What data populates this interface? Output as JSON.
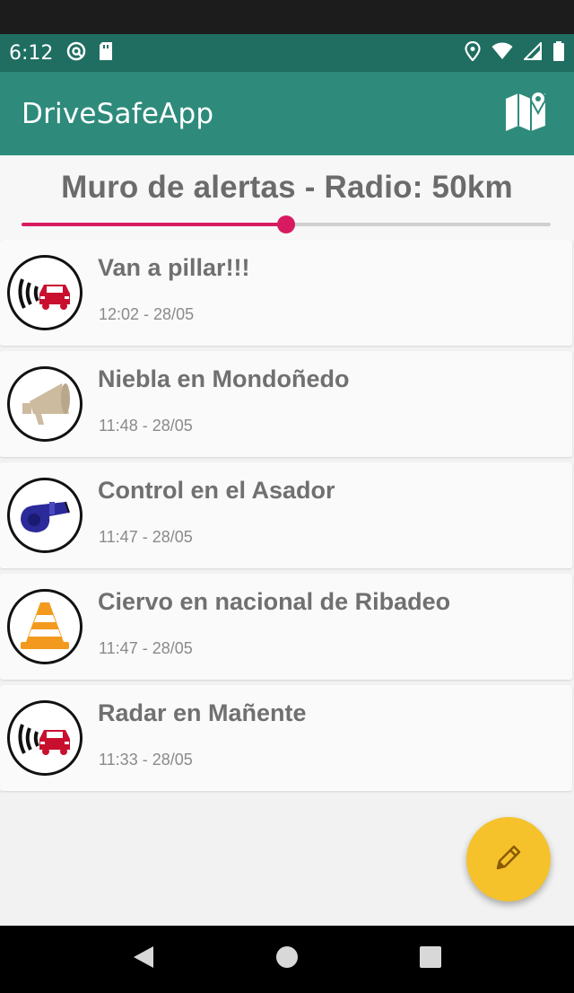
{
  "status_bar": {
    "time": "6:12",
    "icons_left": [
      "sync-icon",
      "sd-card-icon"
    ],
    "icons_right": [
      "location-icon",
      "wifi-icon",
      "signal-icon",
      "battery-icon"
    ]
  },
  "app_bar": {
    "title": "DriveSafeApp",
    "action_icon": "map-icon",
    "color": "#2e8b7c"
  },
  "wall": {
    "title": "Muro de alertas - Radio: 50km",
    "radius_slider": {
      "value_fraction": 0.5,
      "accent": "#d81b60"
    }
  },
  "alerts": [
    {
      "title": "Van a pillar!!!",
      "time": "12:02 - 28/05",
      "icon": "radar-icon"
    },
    {
      "title": "Niebla en Mondoñedo",
      "time": "11:48 - 28/05",
      "icon": "megaphone-icon"
    },
    {
      "title": "Control en el Asador",
      "time": "11:47 - 28/05",
      "icon": "whistle-icon"
    },
    {
      "title": "Ciervo en nacional de Ribadeo",
      "time": "11:47 - 28/05",
      "icon": "traffic-cone-icon"
    },
    {
      "title": "Radar en Mañente",
      "time": "11:33 - 28/05",
      "icon": "radar-icon"
    }
  ],
  "fab": {
    "icon": "pencil-icon",
    "color": "#f5c22c"
  },
  "nav_bar": [
    "back-icon",
    "home-icon",
    "recents-icon"
  ]
}
